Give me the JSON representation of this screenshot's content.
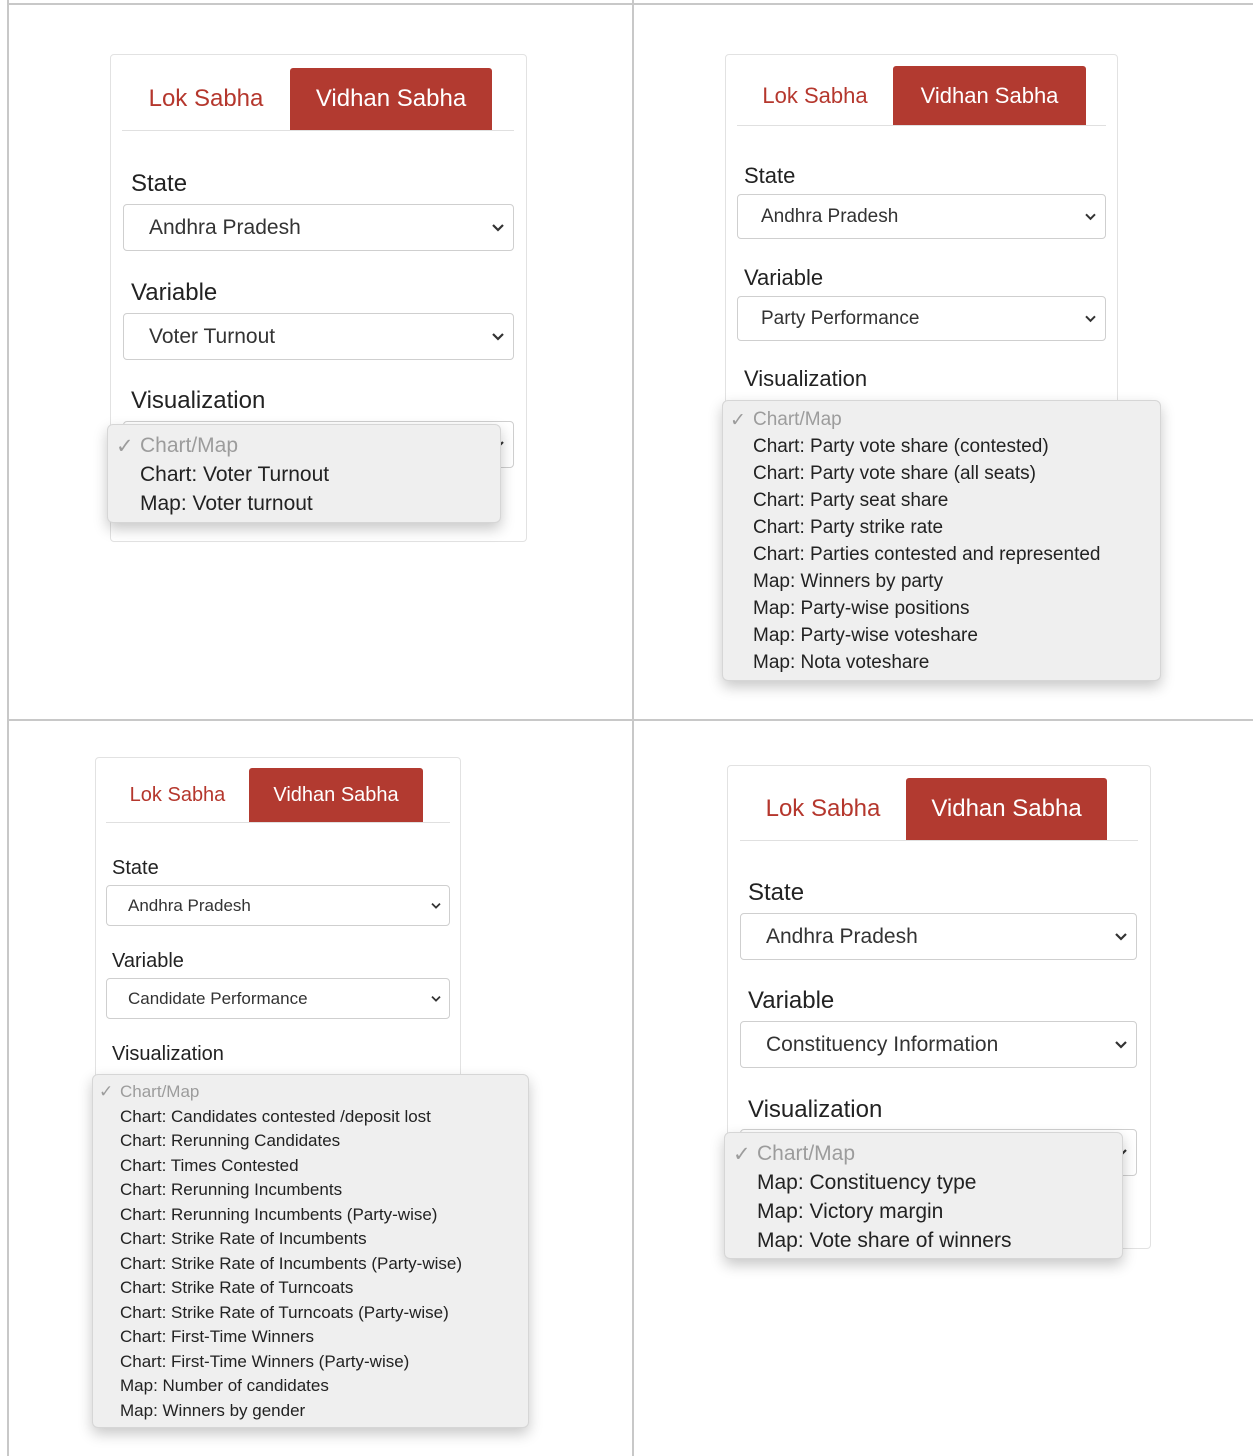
{
  "tabs": {
    "lok": "Lok Sabha",
    "vidhan": "Vidhan Sabha"
  },
  "labels": {
    "state": "State",
    "variable": "Variable",
    "visualization": "Visualization"
  },
  "check_glyph": "✓",
  "panels": [
    {
      "state_value": "Andhra Pradesh",
      "variable_value": "Voter Turnout",
      "options": [
        "Chart/Map",
        "Chart: Voter Turnout",
        "Map: Voter turnout"
      ]
    },
    {
      "state_value": "Andhra Pradesh",
      "variable_value": "Party Performance",
      "options": [
        "Chart/Map",
        "Chart: Party vote share (contested)",
        "Chart: Party vote share (all seats)",
        "Chart: Party seat share",
        "Chart: Party strike rate",
        "Chart: Parties contested and represented",
        "Map: Winners by party",
        "Map: Party-wise positions",
        "Map: Party-wise voteshare",
        "Map: Nota voteshare"
      ]
    },
    {
      "state_value": "Andhra Pradesh",
      "variable_value": "Candidate Performance",
      "options": [
        "Chart/Map",
        "Chart: Candidates contested /deposit lost",
        "Chart: Rerunning Candidates",
        "Chart: Times Contested",
        "Chart: Rerunning Incumbents",
        "Chart: Rerunning Incumbents (Party-wise)",
        "Chart: Strike Rate of Incumbents",
        "Chart: Strike Rate of Incumbents (Party-wise)",
        "Chart: Strike Rate of Turncoats",
        "Chart: Strike Rate of Turncoats (Party-wise)",
        "Chart: First-Time Winners",
        "Chart: First-Time Winners (Party-wise)",
        "Map: Number of candidates",
        "Map: Winners by gender"
      ]
    },
    {
      "state_value": "Andhra Pradesh",
      "variable_value": "Constituency Information",
      "options": [
        "Chart/Map",
        "Map: Constituency type",
        "Map: Victory margin",
        "Map: Vote share of winners"
      ]
    }
  ]
}
